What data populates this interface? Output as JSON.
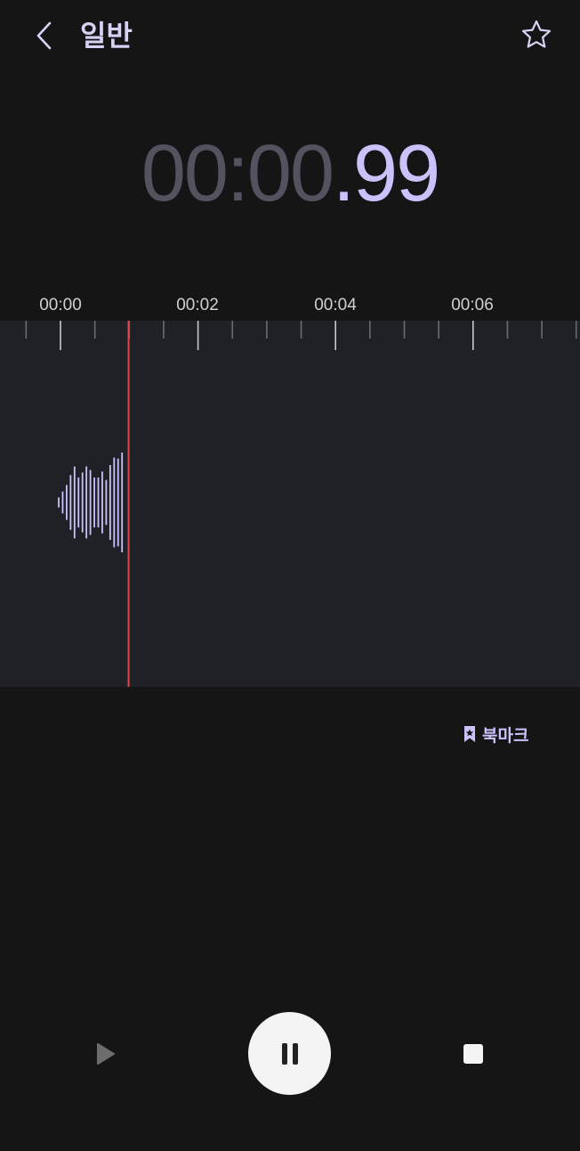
{
  "header": {
    "title": "일반",
    "back_icon": "chevron-left-icon",
    "favorite_icon": "star-outline-icon"
  },
  "timer": {
    "main": "00:00",
    "fraction": ".99"
  },
  "timeline": {
    "labels": [
      "00:00",
      "00:02",
      "00:04",
      "00:06"
    ]
  },
  "waveform": {
    "playhead_seconds": 0.99,
    "amplitudes": [
      0.1,
      0.22,
      0.35,
      0.55,
      0.72,
      0.5,
      0.6,
      0.72,
      0.65,
      0.5,
      0.5,
      0.62,
      0.45,
      0.75,
      0.9,
      0.88,
      1.0
    ]
  },
  "bookmark": {
    "label": "북마크",
    "icon": "bookmark-icon"
  },
  "controls": {
    "play_icon": "play-icon",
    "pause_icon": "pause-icon",
    "stop_icon": "stop-icon"
  },
  "colors": {
    "accent": "#c9c2fb",
    "playhead": "#e0474c",
    "timer_dim": "#55525f",
    "panel": "#202027",
    "background": "#151515"
  }
}
